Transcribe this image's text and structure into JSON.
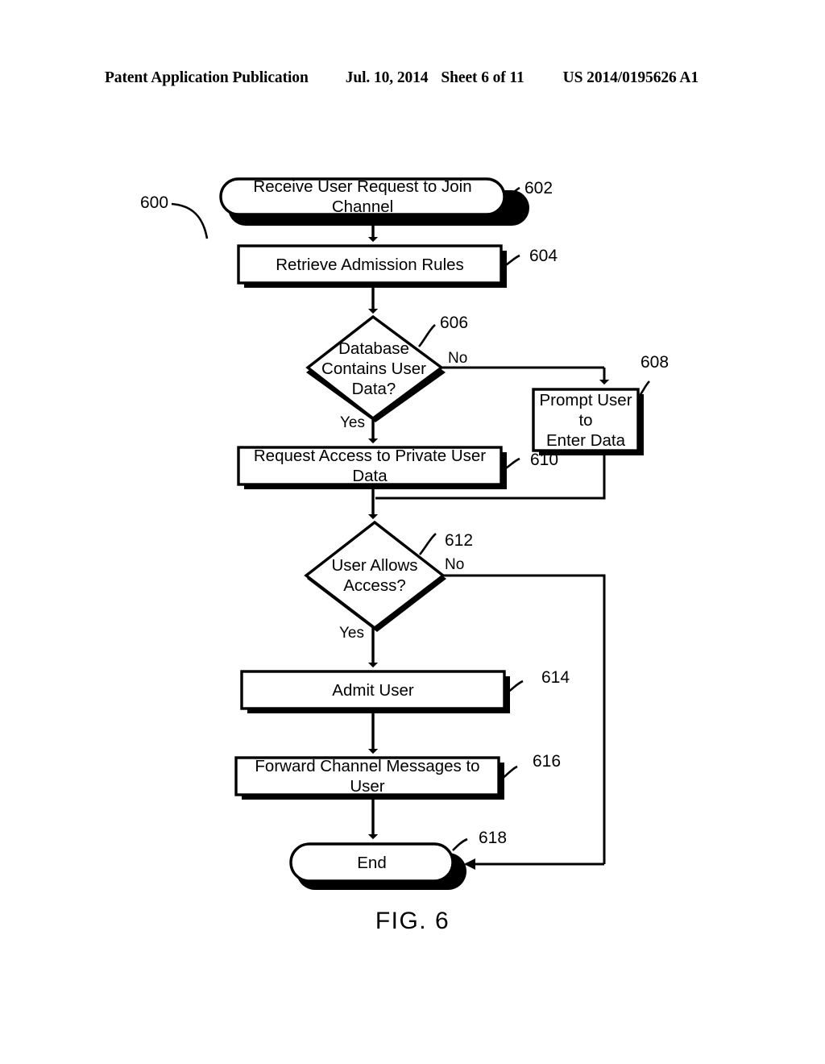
{
  "header": {
    "publication": "Patent Application Publication",
    "date": "Jul. 10, 2014",
    "sheet": "Sheet 6 of 11",
    "patent_number": "US 2014/0195626 A1"
  },
  "figure": {
    "caption": "FIG. 6",
    "diagram_ref": "600"
  },
  "chart_data": {
    "type": "diagram",
    "diagram_type": "flowchart",
    "title": "FIG. 6",
    "overall_ref": "600",
    "nodes": [
      {
        "id": "602",
        "ref": "602",
        "shape": "rounded-rect",
        "label": "Receive User Request to Join Channel"
      },
      {
        "id": "604",
        "ref": "604",
        "shape": "rect",
        "label": "Retrieve Admission Rules"
      },
      {
        "id": "606",
        "ref": "606",
        "shape": "diamond",
        "label": "Database\nContains User\nData?"
      },
      {
        "id": "608",
        "ref": "608",
        "shape": "rect",
        "label": "Prompt User to\nEnter Data"
      },
      {
        "id": "610",
        "ref": "610",
        "shape": "rect",
        "label": "Request Access to Private User Data"
      },
      {
        "id": "612",
        "ref": "612",
        "shape": "diamond",
        "label": "User Allows\nAccess?"
      },
      {
        "id": "614",
        "ref": "614",
        "shape": "rect",
        "label": "Admit User"
      },
      {
        "id": "616",
        "ref": "616",
        "shape": "rect",
        "label": "Forward Channel Messages to User"
      },
      {
        "id": "618",
        "ref": "618",
        "shape": "rounded-rect",
        "label": "End"
      }
    ],
    "edges": [
      {
        "from": "602",
        "to": "604",
        "label": ""
      },
      {
        "from": "604",
        "to": "606",
        "label": ""
      },
      {
        "from": "606",
        "to": "608",
        "label": "No"
      },
      {
        "from": "606",
        "to": "610",
        "label": "Yes"
      },
      {
        "from": "608",
        "to": "610",
        "label": ""
      },
      {
        "from": "610",
        "to": "612",
        "label": ""
      },
      {
        "from": "612",
        "to": "618",
        "label": "No"
      },
      {
        "from": "612",
        "to": "614",
        "label": "Yes"
      },
      {
        "from": "614",
        "to": "616",
        "label": ""
      },
      {
        "from": "616",
        "to": "618",
        "label": ""
      }
    ],
    "edge_labels": {
      "d606_no": "No",
      "d606_yes": "Yes",
      "d612_no": "No",
      "d612_yes": "Yes"
    }
  }
}
